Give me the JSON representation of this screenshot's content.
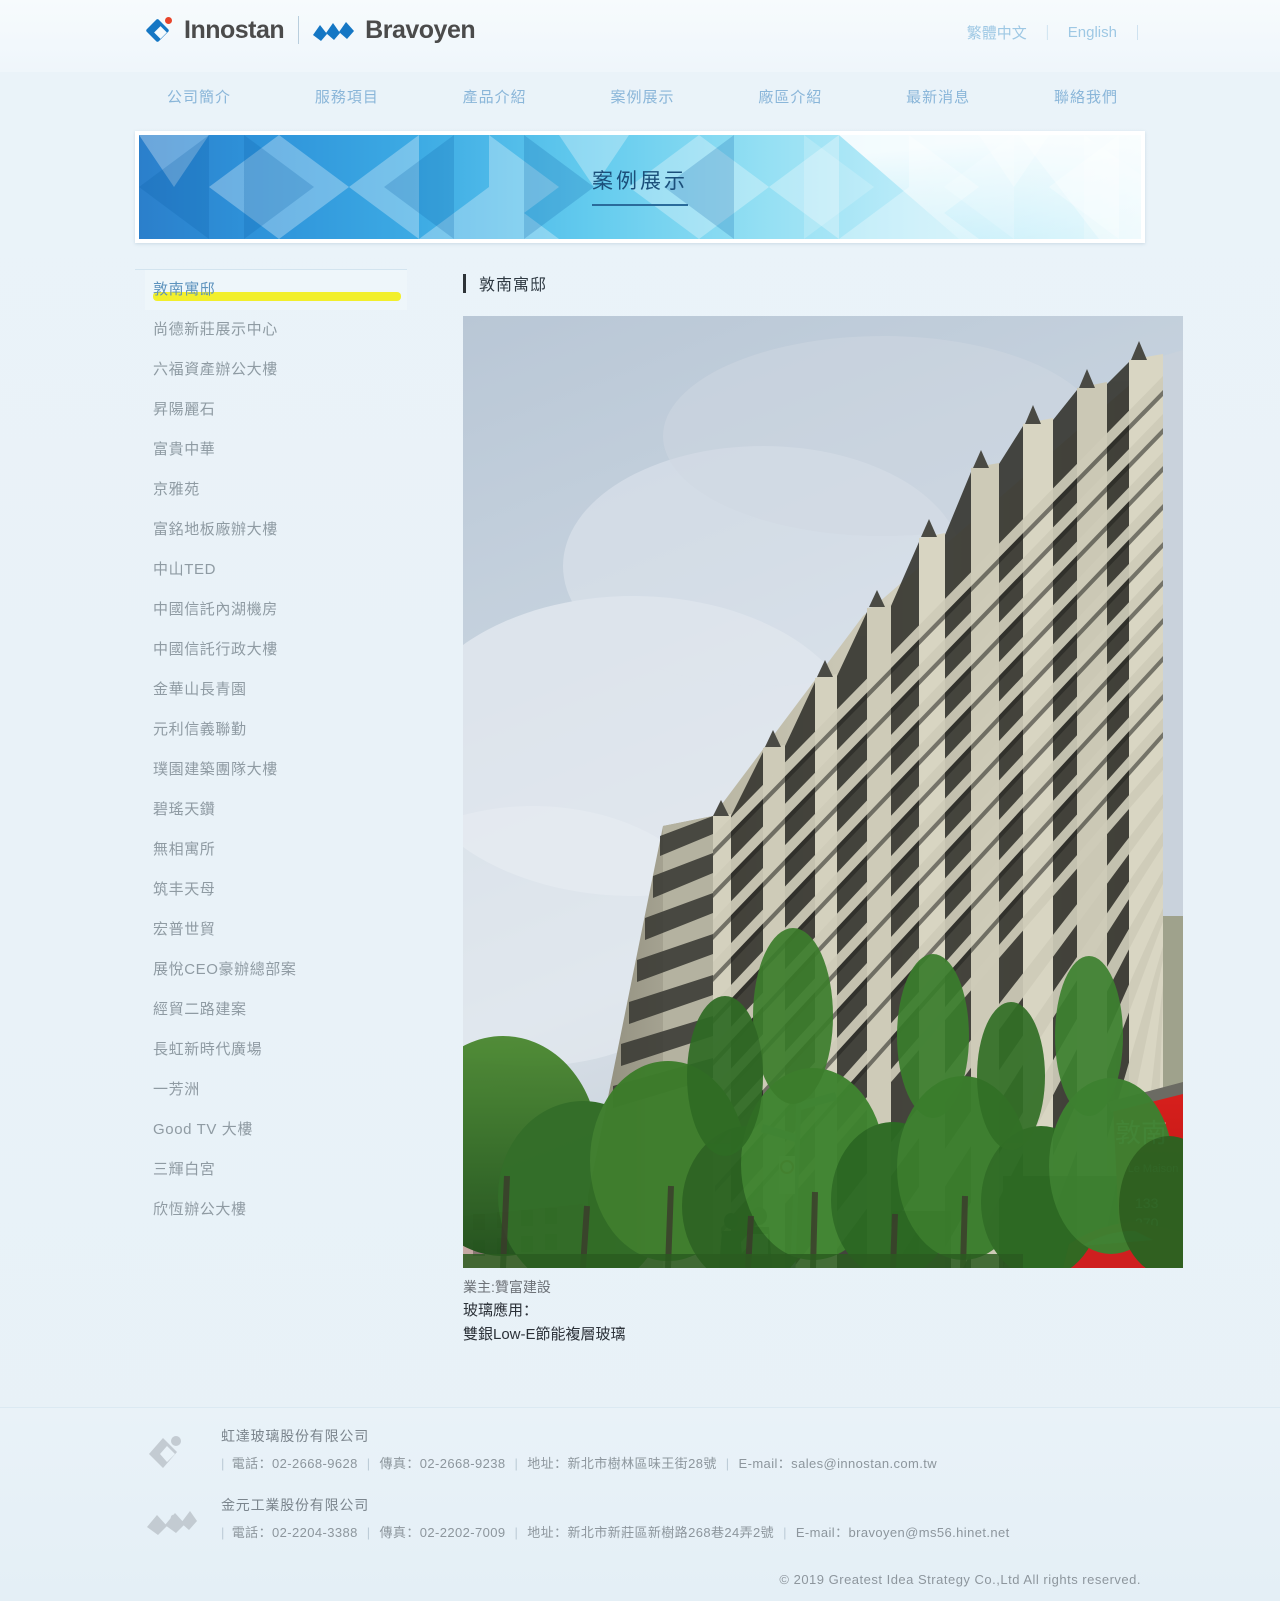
{
  "header": {
    "brand_primary": "Innostan",
    "brand_secondary": "Bravoyen",
    "languages": [
      {
        "label": "繁體中文"
      },
      {
        "label": "English"
      }
    ],
    "lang_divider": "｜"
  },
  "nav": {
    "items": [
      {
        "label": "公司簡介"
      },
      {
        "label": "服務項目"
      },
      {
        "label": "產品介紹"
      },
      {
        "label": "案例展示"
      },
      {
        "label": "廠區介紹"
      },
      {
        "label": "最新消息"
      },
      {
        "label": "聯絡我們"
      }
    ]
  },
  "banner": {
    "title": "案例展示"
  },
  "sidebar": {
    "items": [
      {
        "label": "敦南寓邸",
        "active": true
      },
      {
        "label": "尚德新莊展示中心",
        "active": false
      },
      {
        "label": "六福資產辦公大樓",
        "active": false
      },
      {
        "label": "昇陽麗石",
        "active": false
      },
      {
        "label": "富貴中華",
        "active": false
      },
      {
        "label": "京雅苑",
        "active": false
      },
      {
        "label": "富銘地板廠辦大樓",
        "active": false
      },
      {
        "label": "中山TED",
        "active": false
      },
      {
        "label": "中國信託內湖機房",
        "active": false
      },
      {
        "label": "中國信託行政大樓",
        "active": false
      },
      {
        "label": "金華山長青園",
        "active": false
      },
      {
        "label": "元利信義聯勤",
        "active": false
      },
      {
        "label": "璞園建築團隊大樓",
        "active": false
      },
      {
        "label": "碧瑤天鑽",
        "active": false
      },
      {
        "label": "無相寓所",
        "active": false
      },
      {
        "label": "筑丰天母",
        "active": false
      },
      {
        "label": "宏普世貿",
        "active": false
      },
      {
        "label": "展悅CEO豪辦總部案",
        "active": false
      },
      {
        "label": "經貿二路建案",
        "active": false
      },
      {
        "label": "長虹新時代廣場",
        "active": false
      },
      {
        "label": "一芳洲",
        "active": false
      },
      {
        "label": "Good TV 大樓",
        "active": false
      },
      {
        "label": "三輝白宮",
        "active": false
      },
      {
        "label": "欣恆辦公大樓",
        "active": false
      }
    ]
  },
  "content": {
    "title": "敦南寓邸",
    "photo_alt": "敦南寓邸 高層住宅大樓外觀",
    "photo_sign_text": "敦南寓邸",
    "caption": {
      "owner": "業主:贊富建設",
      "application_label": "玻璃應用：",
      "application_value": "雙銀Low-E節能複層玻璃"
    }
  },
  "footer": {
    "companies": [
      {
        "name": "虹達玻璃股份有限公司",
        "phone_label": "電話：",
        "phone": "02-2668-9628",
        "fax_label": "傳真：",
        "fax": "02-2668-9238",
        "address_label": "地址：",
        "address": "新北市樹林區味王街28號",
        "email_label": "E-mail：",
        "email": "sales@innostan.com.tw"
      },
      {
        "name": "金元工業股份有限公司",
        "phone_label": "電話：",
        "phone": "02-2204-3388",
        "fax_label": "傳真：",
        "fax": "02-2202-7009",
        "address_label": "地址：",
        "address": "新北市新莊區新樹路268巷24弄2號",
        "email_label": "E-mail：",
        "email": "bravoyen@ms56.hinet.net"
      }
    ],
    "copyright": "© 2019 Greatest Idea Strategy Co.,Ltd All rights reserved."
  },
  "colors": {
    "brand_blue": "#1577c4",
    "highlight_yellow": "#f2ef2c",
    "page_bg": "#e9f2f8",
    "nav_link": "#8ab6d9"
  }
}
